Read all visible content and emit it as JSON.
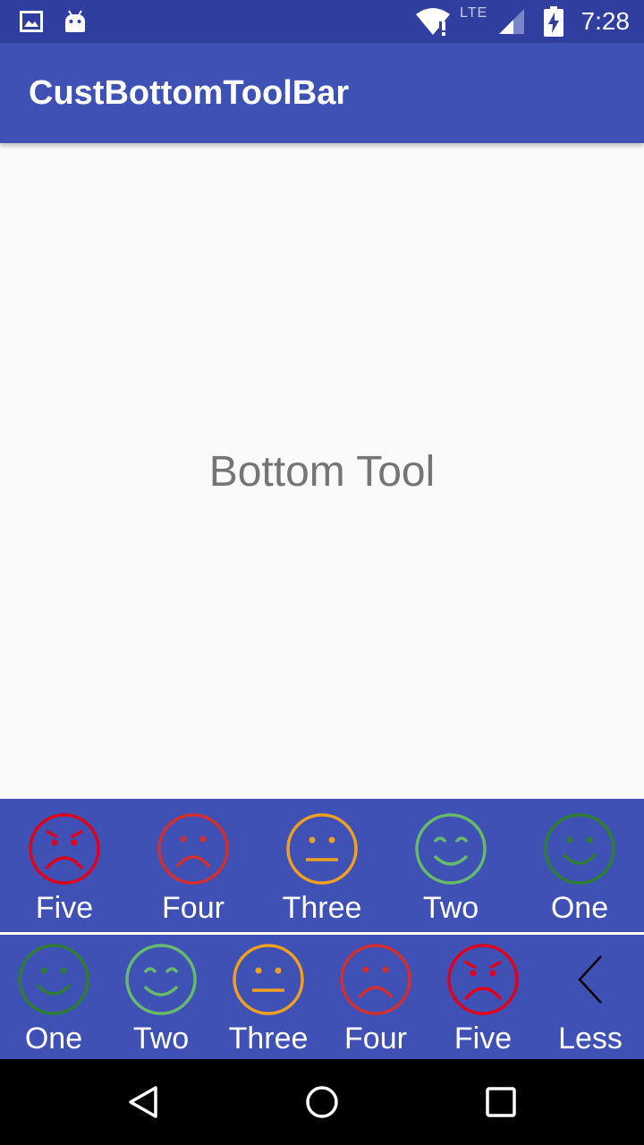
{
  "status_bar": {
    "time": "7:28",
    "icons": [
      "image-icon",
      "android-icon",
      "wifi-icon",
      "lte-icon",
      "signal-icon",
      "battery-charging-icon"
    ],
    "lte_label": "LTE"
  },
  "app_bar": {
    "title": "CustBottomToolBar"
  },
  "content": {
    "text": "Bottom Tool"
  },
  "toolbar_top": {
    "items": [
      {
        "label": "Five",
        "icon": "very-angry-face-icon",
        "color": "#e0001a"
      },
      {
        "label": "Four",
        "icon": "sad-face-icon",
        "color": "#d32f2f"
      },
      {
        "label": "Three",
        "icon": "neutral-face-icon",
        "color": "#f0a020"
      },
      {
        "label": "Two",
        "icon": "smiling-eyes-face-icon",
        "color": "#66bb6a"
      },
      {
        "label": "One",
        "icon": "smile-face-icon",
        "color": "#2e7d32"
      }
    ]
  },
  "toolbar_bottom": {
    "items": [
      {
        "label": "One",
        "icon": "smile-face-icon",
        "color": "#2e7d32"
      },
      {
        "label": "Two",
        "icon": "smiling-eyes-face-icon",
        "color": "#66bb6a"
      },
      {
        "label": "Three",
        "icon": "neutral-face-icon",
        "color": "#f0a020"
      },
      {
        "label": "Four",
        "icon": "sad-face-icon",
        "color": "#d32f2f"
      },
      {
        "label": "Five",
        "icon": "very-angry-face-icon",
        "color": "#e0001a"
      },
      {
        "label": "Less",
        "icon": "chevron-left-icon",
        "color": "#000000"
      }
    ]
  },
  "nav_bar": {
    "buttons": [
      "back-icon",
      "home-icon",
      "recents-icon"
    ]
  },
  "colors": {
    "status_bar": "#303f9f",
    "primary": "#3f51b5",
    "background": "#fafafa",
    "text_secondary": "#757575"
  }
}
